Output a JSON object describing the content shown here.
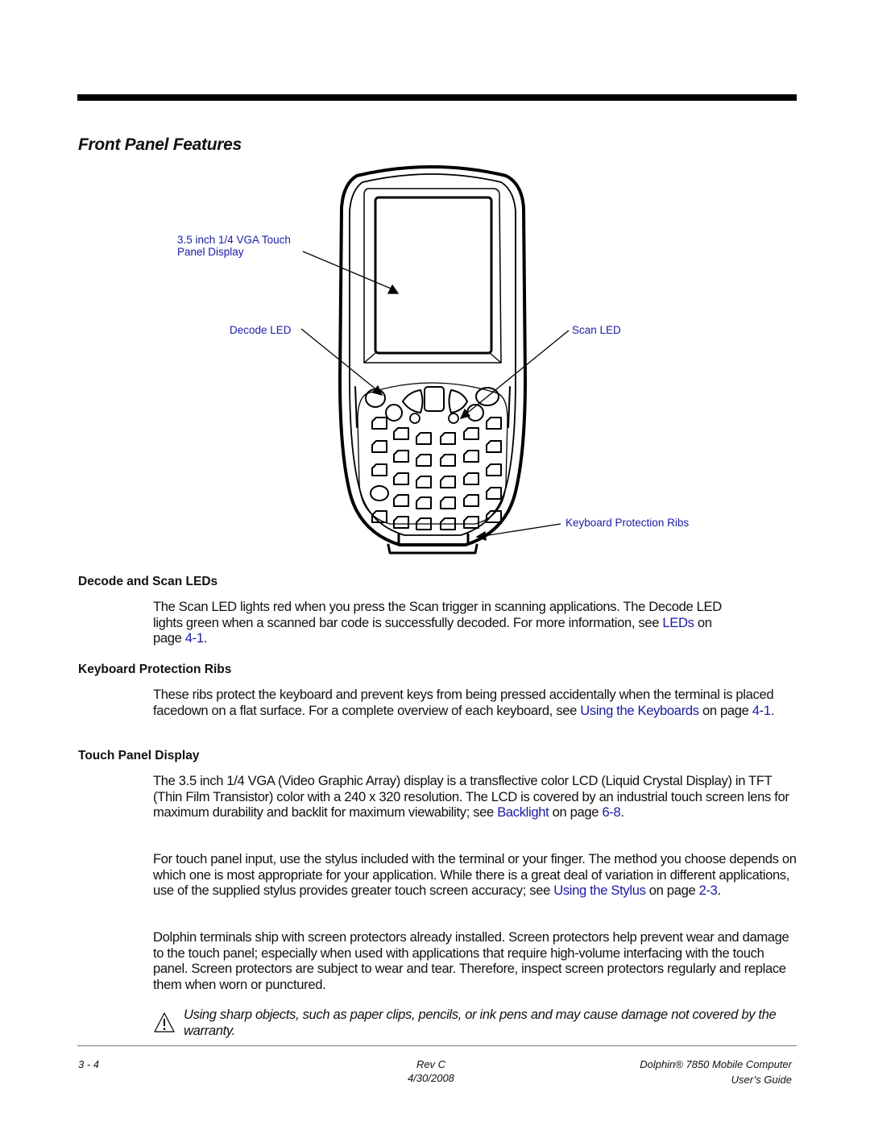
{
  "page": {
    "title": "Front Panel Features"
  },
  "figure": {
    "callouts": {
      "display": [
        "3.5 inch 1/4 VGA Touch",
        "Panel Display"
      ],
      "decode_led": "Decode LED",
      "scan_led": "Scan LED",
      "ribs": "Keyboard Protection Ribs"
    },
    "callout_color": "#1a1aa6"
  },
  "sections": [
    {
      "heading": "Decode and Scan LEDs",
      "paragraphs": [
        {
          "text_before": "The Scan LED lights red when you press the Scan trigger in scanning applications. The Decode LED lights green when a scanned bar code is successfully decoded. For more information, see ",
          "link": "LEDs",
          "text_middle": " on page ",
          "page_link": "4-1",
          "text_after": "."
        }
      ]
    },
    {
      "heading": "Keyboard Protection Ribs",
      "paragraphs": [
        {
          "text_before": "These ribs protect the keyboard and prevent keys from being pressed accidentally when the terminal is placed facedown on a flat surface. For a complete overview of each keyboard, see ",
          "link": "Using the Keyboards",
          "text_middle": " on page ",
          "page_link": "4-1",
          "text_after": "."
        }
      ]
    },
    {
      "heading": "Touch Panel Display",
      "paragraphs": [
        {
          "text_before": "The 3.5 inch 1/4 VGA (Video Graphic Array) display is a transflective color LCD (Liquid Crystal Display) in TFT (Thin Film Transistor) color with a 240 x 320 resolution. The LCD is covered by an industrial touch screen lens for maximum durability and backlit for maximum viewability; see ",
          "link": "Backlight",
          "text_middle": " on page ",
          "page_link": "6-8",
          "text_after": "."
        },
        {
          "text_before": "For touch panel input, use the stylus included with the terminal or your finger. The method you choose depends on which one is most appropriate for your application. While there is a great deal of variation in different applications, use of the supplied stylus provides greater touch screen accuracy; see ",
          "link": "Using the Stylus",
          "text_middle": " on page ",
          "page_link": "2-3",
          "text_after": "."
        },
        {
          "text": "Dolphin terminals ship with screen protectors already installed. Screen protectors help prevent wear and damage to the touch panel; especially when used with applications that require high-volume interfacing with the touch panel. Screen protectors are subject to wear and tear. Therefore, inspect screen protectors regularly and replace them when worn or punctured."
        }
      ]
    }
  ],
  "caution": {
    "icon": "warning-triangle-icon",
    "text": "Using sharp objects, such as paper clips, pencils, or ink pens and may cause damage not covered by the warranty."
  },
  "footer": {
    "page_number": "3 - 4",
    "revision": "Rev C",
    "date": "4/30/2008",
    "product": "Dolphin® 7850 Mobile Computer",
    "doc_type": "User’s Guide"
  }
}
